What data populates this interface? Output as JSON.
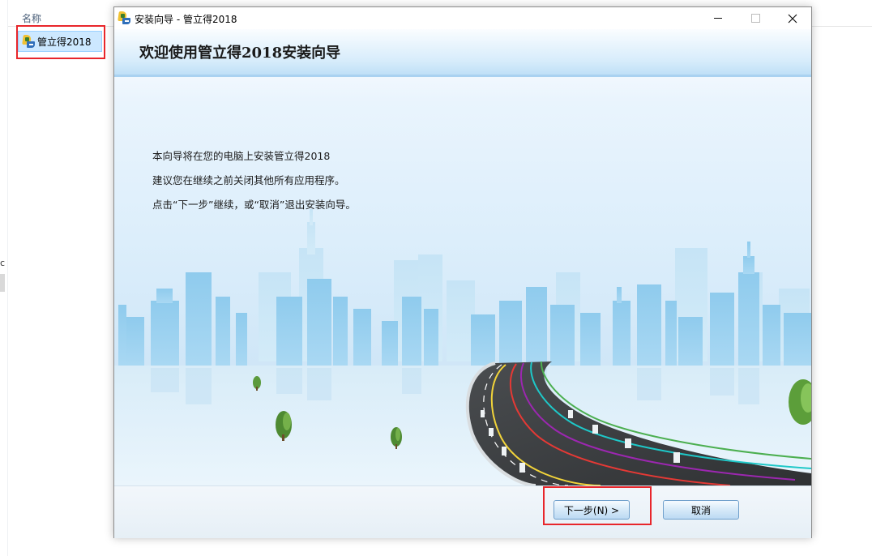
{
  "explorer": {
    "column_header": "名称",
    "selected_item": {
      "label": "管立得2018",
      "icon": "app-icon"
    },
    "nav_fragment": "c"
  },
  "installer": {
    "window_title": "安装向导 - 管立得2018",
    "caption_buttons": [
      "minimize",
      "maximize",
      "close"
    ],
    "heading": "欢迎使用管立得2018安装向导",
    "intro_lines": [
      "本向导将在您的电脑上安装管立得2018",
      "建议您在继续之前关闭其他所有应用程序。",
      "点击“下一步”继续，或“取消”退出安装向导。"
    ],
    "buttons": {
      "next": "下一步(N) >",
      "cancel": "取消"
    }
  },
  "colors": {
    "highlight": "#e8262b",
    "header_band": "#d7ecfb",
    "selection": "#cce8ff",
    "road_lane_colors": [
      "#f2d43a",
      "#e53935",
      "#9c27b0",
      "#1ec8c8",
      "#4caf50",
      "#ffffff"
    ]
  }
}
